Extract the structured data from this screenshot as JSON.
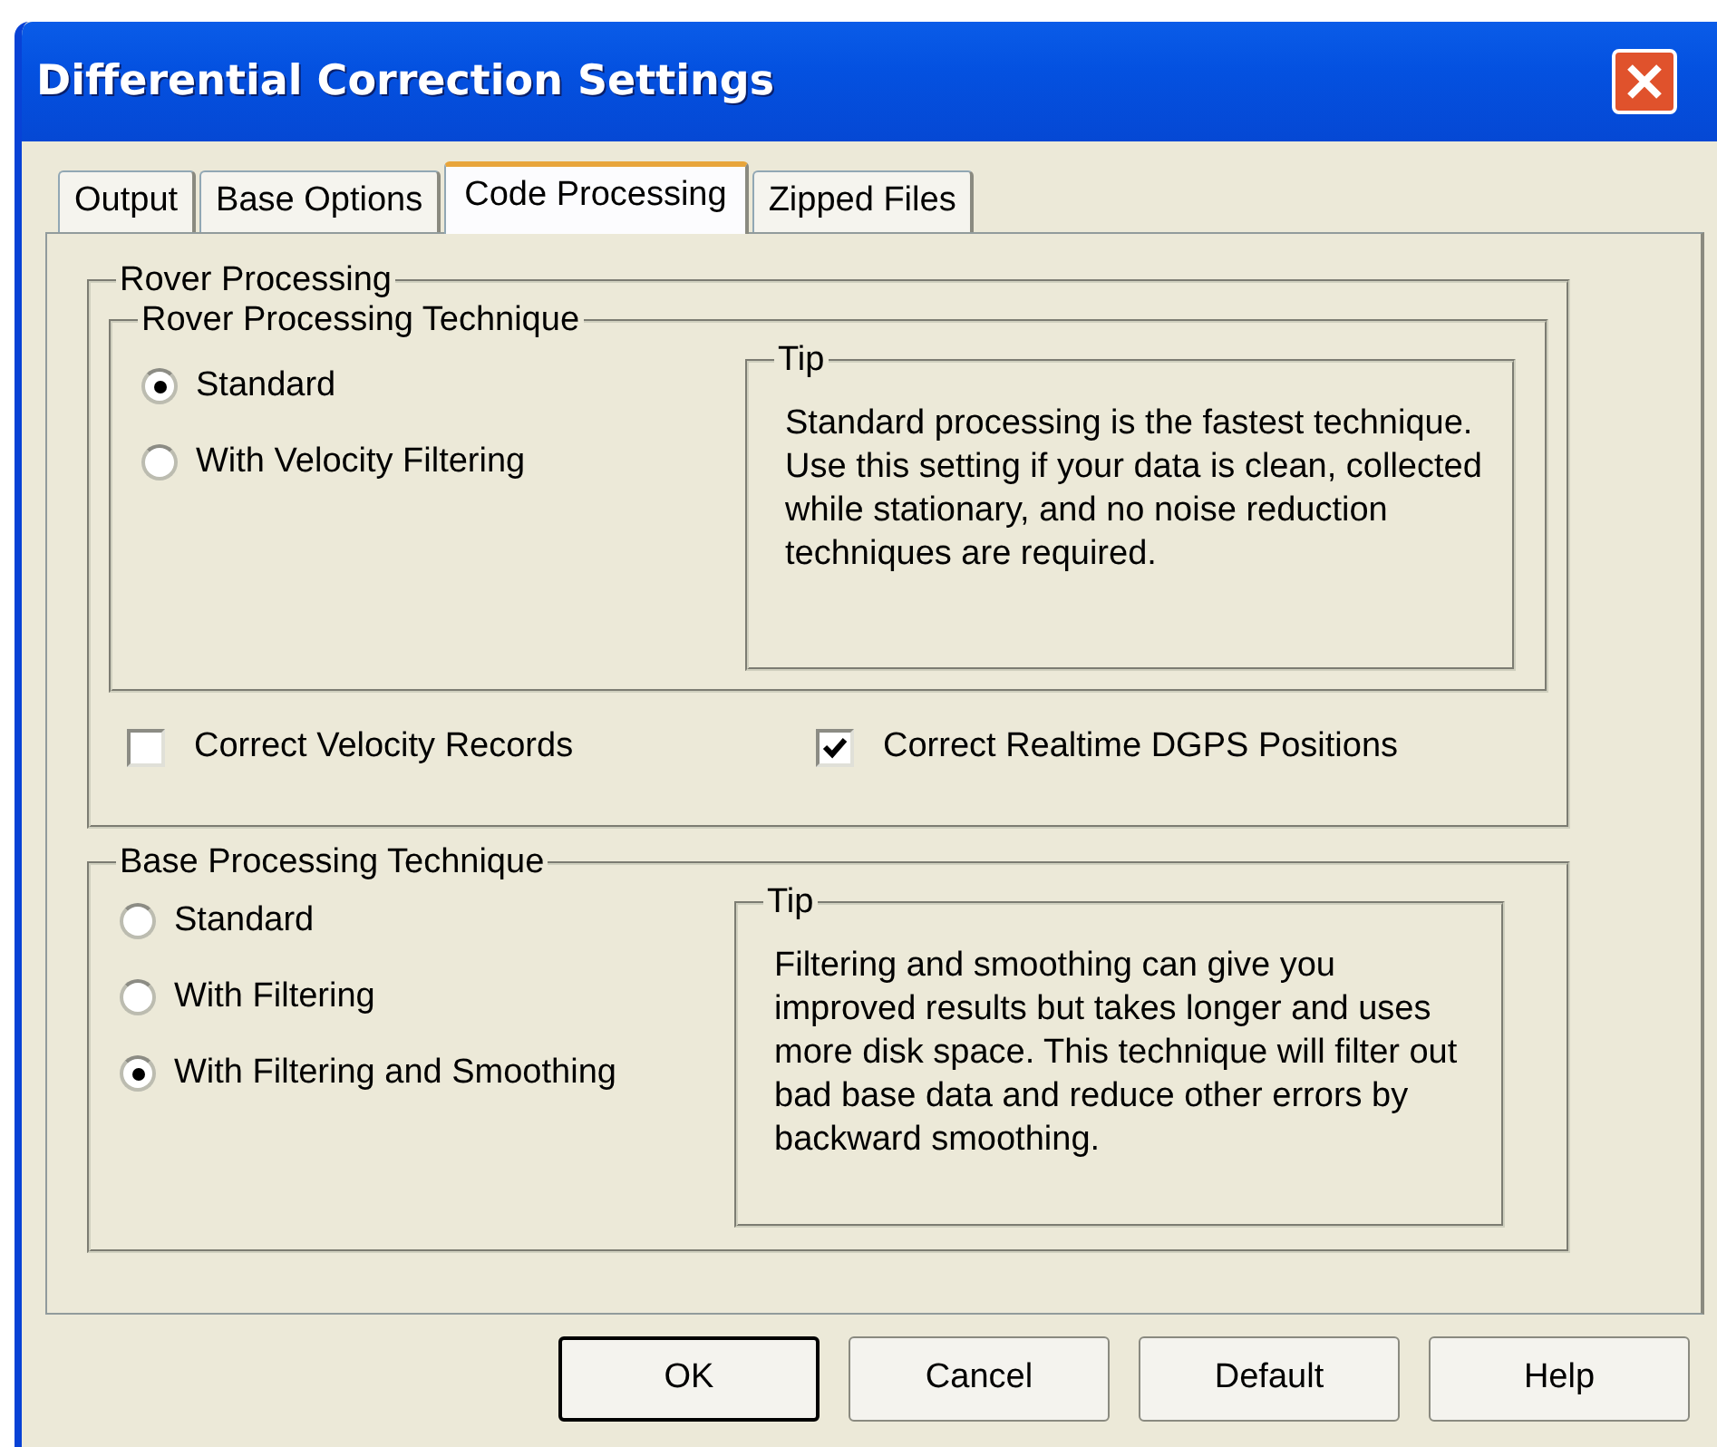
{
  "window": {
    "title": "Differential Correction Settings"
  },
  "tabs": [
    {
      "label": "Output",
      "selected": false
    },
    {
      "label": "Base Options",
      "selected": false
    },
    {
      "label": "Code Processing",
      "selected": true
    },
    {
      "label": "Zipped Files",
      "selected": false
    }
  ],
  "rover_processing": {
    "title": "Rover Processing",
    "technique": {
      "title": "Rover Processing Technique",
      "options": [
        {
          "label": "Standard",
          "selected": true
        },
        {
          "label": "With Velocity Filtering",
          "selected": false
        }
      ],
      "tip": {
        "title": "Tip",
        "text": "Standard processing is the fastest technique. Use this setting if your data is clean, collected while stationary, and no noise reduction techniques are required."
      }
    },
    "checkboxes": [
      {
        "label": "Correct Velocity Records",
        "checked": false
      },
      {
        "label": "Correct Realtime DGPS Positions",
        "checked": true
      }
    ]
  },
  "base_processing": {
    "title": "Base Processing Technique",
    "options": [
      {
        "label": "Standard",
        "selected": false
      },
      {
        "label": "With Filtering",
        "selected": false
      },
      {
        "label": "With Filtering and Smoothing",
        "selected": true
      }
    ],
    "tip": {
      "title": "Tip",
      "text": "Filtering and smoothing can give you improved results but takes longer and uses more disk space. This technique will filter out bad base data and reduce other errors by backward smoothing."
    }
  },
  "buttons": [
    {
      "label": "OK",
      "default": true
    },
    {
      "label": "Cancel",
      "default": false
    },
    {
      "label": "Default",
      "default": false
    },
    {
      "label": "Help",
      "default": false
    }
  ]
}
